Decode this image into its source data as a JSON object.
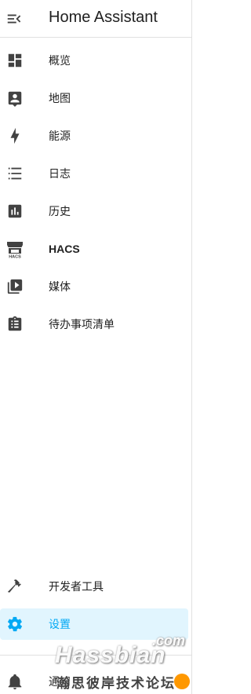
{
  "header": {
    "title": "Home Assistant",
    "menu_icon": "menu-open-icon"
  },
  "nav": {
    "items": [
      {
        "label": "概览",
        "icon": "dashboard-icon"
      },
      {
        "label": "地图",
        "icon": "map-account-icon"
      },
      {
        "label": "能源",
        "icon": "lightning-bolt-icon"
      },
      {
        "label": "日志",
        "icon": "list-icon"
      },
      {
        "label": "历史",
        "icon": "chart-box-icon"
      },
      {
        "label": "HACS",
        "icon": "hacs-store-icon"
      },
      {
        "label": "媒体",
        "icon": "play-box-multiple-icon"
      },
      {
        "label": "待办事项清单",
        "icon": "clipboard-list-icon"
      }
    ],
    "bottom_items": [
      {
        "label": "开发者工具",
        "icon": "hammer-icon"
      },
      {
        "label": "设置",
        "icon": "cog-icon",
        "selected": true
      }
    ],
    "notifications": {
      "label": "通知",
      "icon": "bell-icon"
    }
  },
  "watermark": {
    "brand": "Hassbian",
    "com": ".com",
    "subtitle": "瀚思彼岸技术论坛"
  },
  "colors": {
    "icon": "#424242",
    "selected_bg": "#e1f5fe",
    "selected_accent": "#03a9f4",
    "divider": "#e0e0e0"
  }
}
